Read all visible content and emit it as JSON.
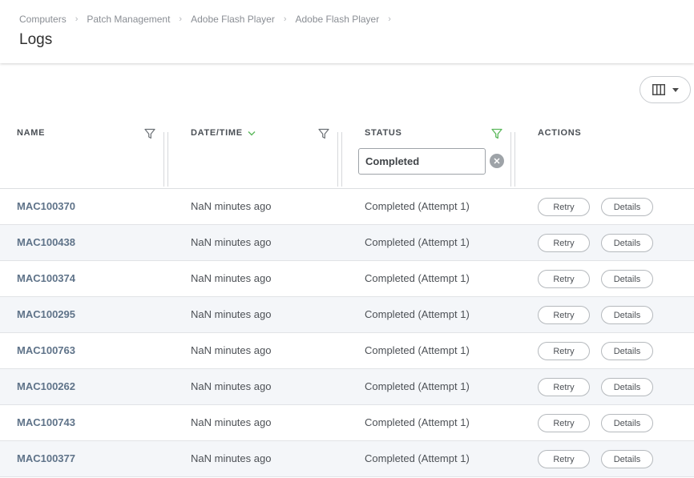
{
  "breadcrumb": [
    "Computers",
    "Patch Management",
    "Adobe Flash Player",
    "Adobe Flash Player"
  ],
  "page_title": "Logs",
  "table": {
    "headers": {
      "name": "NAME",
      "datetime": "DATE/TIME",
      "status": "STATUS",
      "actions": "ACTIONS"
    },
    "status_filter_value": "Completed",
    "rows": [
      {
        "name": "MAC100370",
        "date": "NaN minutes ago",
        "status": "Completed (Attempt 1)",
        "retry": "Retry",
        "details": "Details"
      },
      {
        "name": "MAC100438",
        "date": "NaN minutes ago",
        "status": "Completed (Attempt 1)",
        "retry": "Retry",
        "details": "Details"
      },
      {
        "name": "MAC100374",
        "date": "NaN minutes ago",
        "status": "Completed (Attempt 1)",
        "retry": "Retry",
        "details": "Details"
      },
      {
        "name": "MAC100295",
        "date": "NaN minutes ago",
        "status": "Completed (Attempt 1)",
        "retry": "Retry",
        "details": "Details"
      },
      {
        "name": "MAC100763",
        "date": "NaN minutes ago",
        "status": "Completed (Attempt 1)",
        "retry": "Retry",
        "details": "Details"
      },
      {
        "name": "MAC100262",
        "date": "NaN minutes ago",
        "status": "Completed (Attempt 1)",
        "retry": "Retry",
        "details": "Details"
      },
      {
        "name": "MAC100743",
        "date": "NaN minutes ago",
        "status": "Completed (Attempt 1)",
        "retry": "Retry",
        "details": "Details"
      },
      {
        "name": "MAC100377",
        "date": "NaN minutes ago",
        "status": "Completed (Attempt 1)",
        "retry": "Retry",
        "details": "Details"
      }
    ]
  },
  "icons": {
    "filter": "filter-icon",
    "filter_active": "filter-active-icon",
    "sort": "chevron-down-icon",
    "columns": "columns-icon",
    "clear": "close-icon"
  },
  "colors": {
    "accent_green": "#5cb85c",
    "link": "#5f7389",
    "row_alt": "#f4f6f9"
  }
}
